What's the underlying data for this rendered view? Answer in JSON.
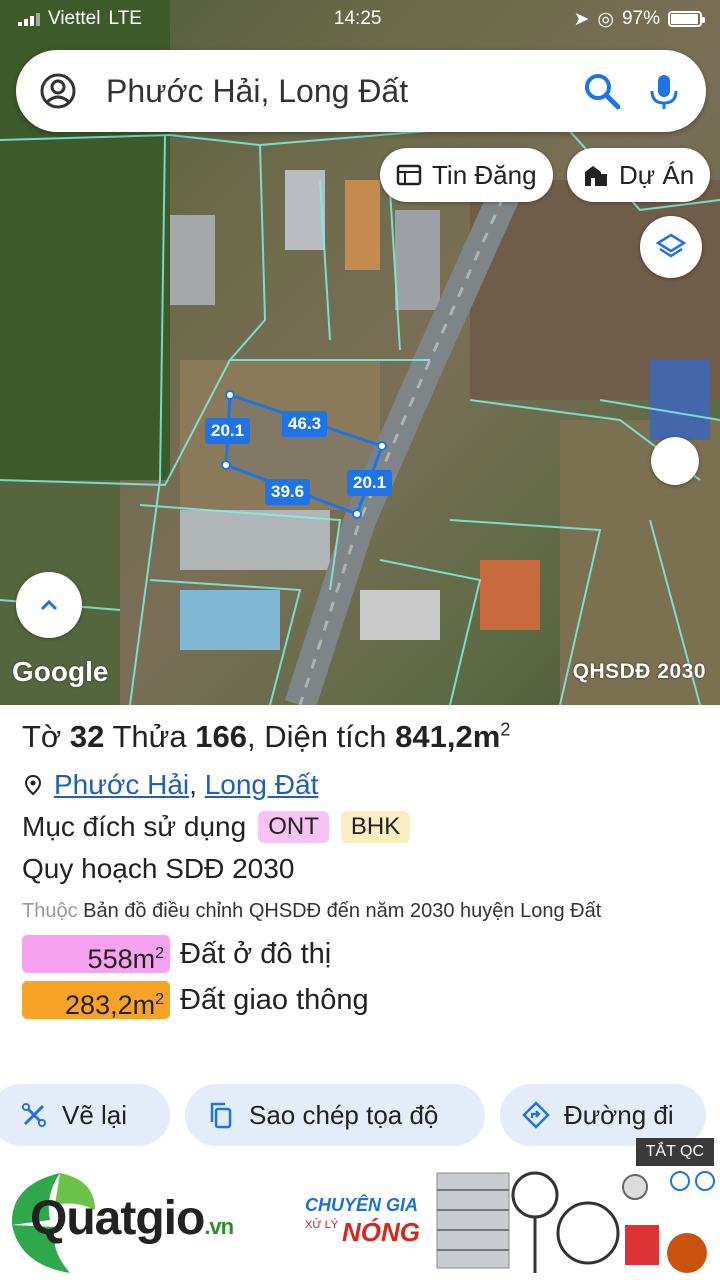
{
  "status": {
    "carrier": "Viettel",
    "network": "LTE",
    "time": "14:25",
    "battery": "97%",
    "battery_level": 0.97
  },
  "search": {
    "query": "Phước Hải, Long Đất"
  },
  "chips": {
    "listing": "Tin Đăng",
    "project": "Dự Án"
  },
  "map": {
    "google_label": "Google",
    "overlay_label": "QHSDĐ 2030",
    "dimensions": [
      "20.1",
      "46.3",
      "39.6",
      "20.1"
    ]
  },
  "parcel": {
    "sheet_label": "Tờ",
    "sheet_no": "32",
    "lot_label": "Thửa",
    "lot_no": "166",
    "area_label": "Diện tích",
    "area_value": "841,2m",
    "area_unit_sup": "2",
    "location_1": "Phước Hải",
    "location_2": "Long Đất",
    "location_sep": ",",
    "purpose_label": "Mục đích sử dụng",
    "purpose_tags": [
      "ONT",
      "BHK"
    ],
    "plan_title": "Quy hoạch SDĐ 2030",
    "note_prefix": "Thuộc",
    "note_text": "Bản đồ điều chỉnh QHSDĐ đến năm 2030 huyện Long Đất",
    "legend": [
      {
        "value": "558m",
        "sup": "2",
        "label": "Đất ở đô thị",
        "color": "#f5a3ee"
      },
      {
        "value": "283,2m",
        "sup": "2",
        "label": "Đất giao thông",
        "color": "#f7a328"
      }
    ]
  },
  "actions": {
    "redraw": "Vẽ lại",
    "copy_coords": "Sao chép tọa độ",
    "directions": "Đường đi"
  },
  "ad": {
    "close_label": "TẮT QC",
    "brand": "Quatgio",
    "brand_tld": ".vn",
    "slogan_1": "CHUYÊN GIA",
    "slogan_2": "XỬ LÝ",
    "slogan_3": "NÓNG"
  },
  "colors": {
    "accent": "#1e74e6",
    "action_bg": "#e3ecf8",
    "tag_ont": "#f6c3f2",
    "tag_bhk": "#fbeec0"
  }
}
